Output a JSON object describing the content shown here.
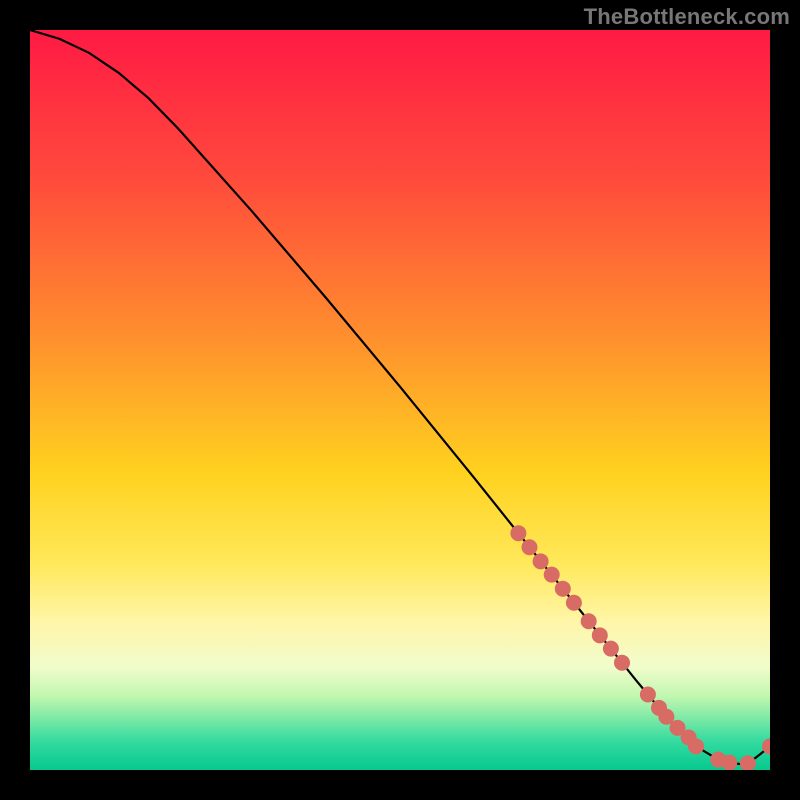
{
  "watermark": {
    "text": "TheBottleneck.com"
  },
  "chart_data": {
    "type": "line",
    "title": "",
    "xlabel": "",
    "ylabel": "",
    "xlim": [
      0,
      100
    ],
    "ylim": [
      0,
      100
    ],
    "grid": false,
    "legend": false,
    "gradient_stops": [
      {
        "offset": 0.0,
        "color": "#ff1a44"
      },
      {
        "offset": 0.2,
        "color": "#ff4a3c"
      },
      {
        "offset": 0.4,
        "color": "#ff8a2f"
      },
      {
        "offset": 0.6,
        "color": "#ffd21f"
      },
      {
        "offset": 0.72,
        "color": "#ffe85a"
      },
      {
        "offset": 0.8,
        "color": "#fff6a8"
      },
      {
        "offset": 0.86,
        "color": "#f1fccc"
      },
      {
        "offset": 0.9,
        "color": "#c2f7b0"
      },
      {
        "offset": 0.93,
        "color": "#7de9a6"
      },
      {
        "offset": 0.96,
        "color": "#36dba0"
      },
      {
        "offset": 1.0,
        "color": "#06c98f"
      }
    ],
    "series": [
      {
        "name": "curve",
        "kind": "line",
        "color": "#000000",
        "x": [
          0,
          4,
          8,
          12,
          16,
          20,
          30,
          40,
          50,
          60,
          66,
          70,
          74,
          78,
          82,
          86,
          88,
          90,
          92,
          94,
          96,
          98,
          100
        ],
        "y": [
          100,
          98.8,
          96.9,
          94.2,
          90.8,
          86.7,
          75.5,
          63.8,
          51.8,
          39.5,
          32.0,
          27.0,
          22.0,
          17.0,
          12.0,
          7.2,
          5.0,
          3.2,
          2.0,
          1.1,
          0.8,
          1.6,
          3.2
        ]
      },
      {
        "name": "markers",
        "kind": "scatter",
        "color": "#d86b64",
        "x": [
          66,
          67.5,
          69,
          70.5,
          72,
          73.5,
          75.5,
          77,
          78.5,
          80,
          83.5,
          85,
          86,
          87.5,
          89,
          90,
          93,
          94.5,
          97,
          100
        ],
        "y": [
          32.0,
          30.1,
          28.2,
          26.4,
          24.5,
          22.6,
          20.1,
          18.2,
          16.4,
          14.5,
          10.2,
          8.4,
          7.2,
          5.7,
          4.4,
          3.2,
          1.4,
          1.0,
          0.9,
          3.2
        ]
      }
    ]
  }
}
